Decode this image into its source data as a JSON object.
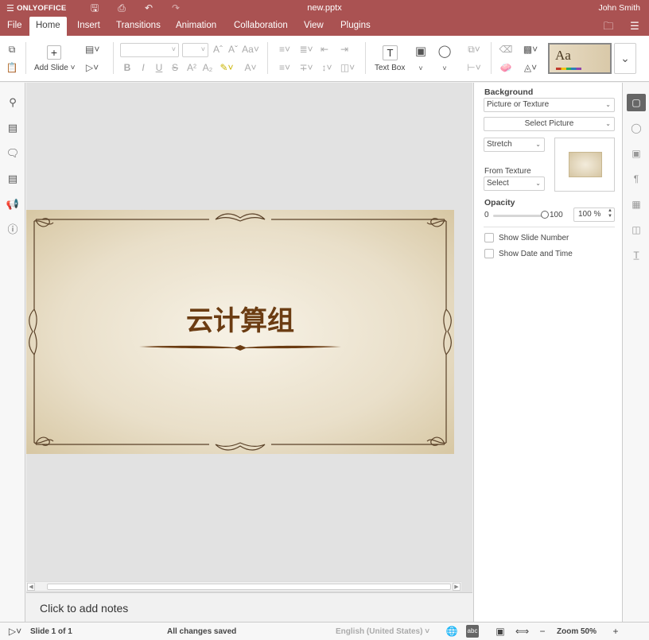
{
  "app": {
    "brand": "ONLYOFFICE",
    "doc_title": "new.pptx",
    "user": "John Smith"
  },
  "menu": {
    "tabs": [
      {
        "label": "File"
      },
      {
        "label": "Home"
      },
      {
        "label": "Insert"
      },
      {
        "label": "Transitions"
      },
      {
        "label": "Animation"
      },
      {
        "label": "Collaboration"
      },
      {
        "label": "View"
      },
      {
        "label": "Plugins"
      }
    ],
    "active_tab": "Home"
  },
  "toolbar": {
    "add_slide_label": "Add Slide",
    "text_box_label": "Text Box",
    "theme_preview_label": "Aa",
    "font_name_value": "",
    "font_size_value": ""
  },
  "slide": {
    "title": "云计算组",
    "background_colors": [
      "#f7f2e6",
      "#e9dfc9",
      "#d7c7a3"
    ]
  },
  "notes": {
    "placeholder": "Click to add notes"
  },
  "right_panel": {
    "background_heading": "Background",
    "fill_type": "Picture or Texture",
    "select_picture": "Select Picture",
    "stretch_mode": "Stretch",
    "from_texture_label": "From Texture",
    "texture_select": "Select",
    "opacity_heading": "Opacity",
    "opacity_min": "0",
    "opacity_max": "100",
    "opacity_value": "100 %",
    "opacity_level": 1.0,
    "show_slide_number": "Show Slide Number",
    "show_date_time": "Show Date and Time"
  },
  "status": {
    "slide_info": "Slide 1 of 1",
    "save_status": "All changes saved",
    "language": "English (United States)",
    "zoom": "Zoom 50%"
  },
  "colors": {
    "accent": "#aa5252",
    "slide_title": "#6b3c12",
    "ornament": "#5a4128"
  }
}
